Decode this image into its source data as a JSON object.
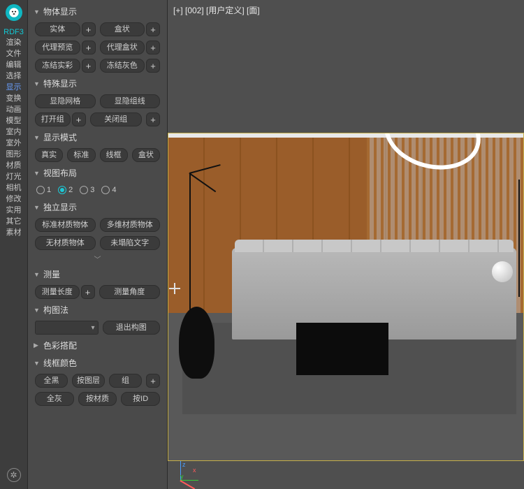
{
  "leftNav": {
    "items": [
      "RDF3",
      "渲染",
      "文件",
      "编辑",
      "选择",
      "显示",
      "变换",
      "动画",
      "模型",
      "室内",
      "室外",
      "图形",
      "材质",
      "灯光",
      "相机",
      "修改",
      "实用",
      "其它",
      "素材"
    ],
    "highlight1": 0,
    "highlight2": 5
  },
  "viewport": {
    "label": "[+]  [002]  [用户定义]  [面]",
    "gizmo": {
      "x": "x",
      "y": "y",
      "z": "z"
    }
  },
  "panel": {
    "sections": [
      {
        "title": "物体显示",
        "open": true,
        "rows": [
          {
            "type": "btnplus2",
            "a": "实体",
            "b": "盒状"
          },
          {
            "type": "btnplus2",
            "a": "代理预览",
            "b": "代理盒状"
          },
          {
            "type": "btnplus2",
            "a": "冻结实彩",
            "b": "冻结灰色"
          }
        ]
      },
      {
        "title": "特殊显示",
        "open": true,
        "rows": [
          {
            "type": "btn2",
            "a": "显隐网格",
            "b": "显隐组线"
          },
          {
            "type": "btn2plus",
            "a": "打开组",
            "b": "关闭组"
          }
        ]
      },
      {
        "title": "显示模式",
        "open": true,
        "rows": [
          {
            "type": "btn4",
            "a": "真实",
            "b": "标准",
            "c": "线框",
            "d": "盒状"
          }
        ]
      },
      {
        "title": "视图布局",
        "open": true,
        "rows": [
          {
            "type": "radio4",
            "opts": [
              "1",
              "2",
              "3",
              "4"
            ],
            "sel": 1
          }
        ]
      },
      {
        "title": "独立显示",
        "open": true,
        "rows": [
          {
            "type": "btn2",
            "a": "标准材质物体",
            "b": "多维材质物体"
          },
          {
            "type": "btn2",
            "a": "无材质物体",
            "b": "未塌陷文字"
          },
          {
            "type": "chev"
          }
        ]
      },
      {
        "title": "测量",
        "open": true,
        "rows": [
          {
            "type": "btnplus_btn",
            "a": "测量长度",
            "b": "测量角度"
          }
        ]
      },
      {
        "title": "构图法",
        "open": true,
        "rows": [
          {
            "type": "combo_btn",
            "b": "退出构图"
          }
        ]
      },
      {
        "title": "色彩搭配",
        "open": false,
        "rows": []
      },
      {
        "title": "线框颜色",
        "open": true,
        "rows": [
          {
            "type": "btn3plus",
            "a": "全黑",
            "b": "按图层",
            "c": "组"
          },
          {
            "type": "btn3",
            "a": "全灰",
            "b": "按材质",
            "c": "按ID"
          }
        ]
      }
    ]
  }
}
